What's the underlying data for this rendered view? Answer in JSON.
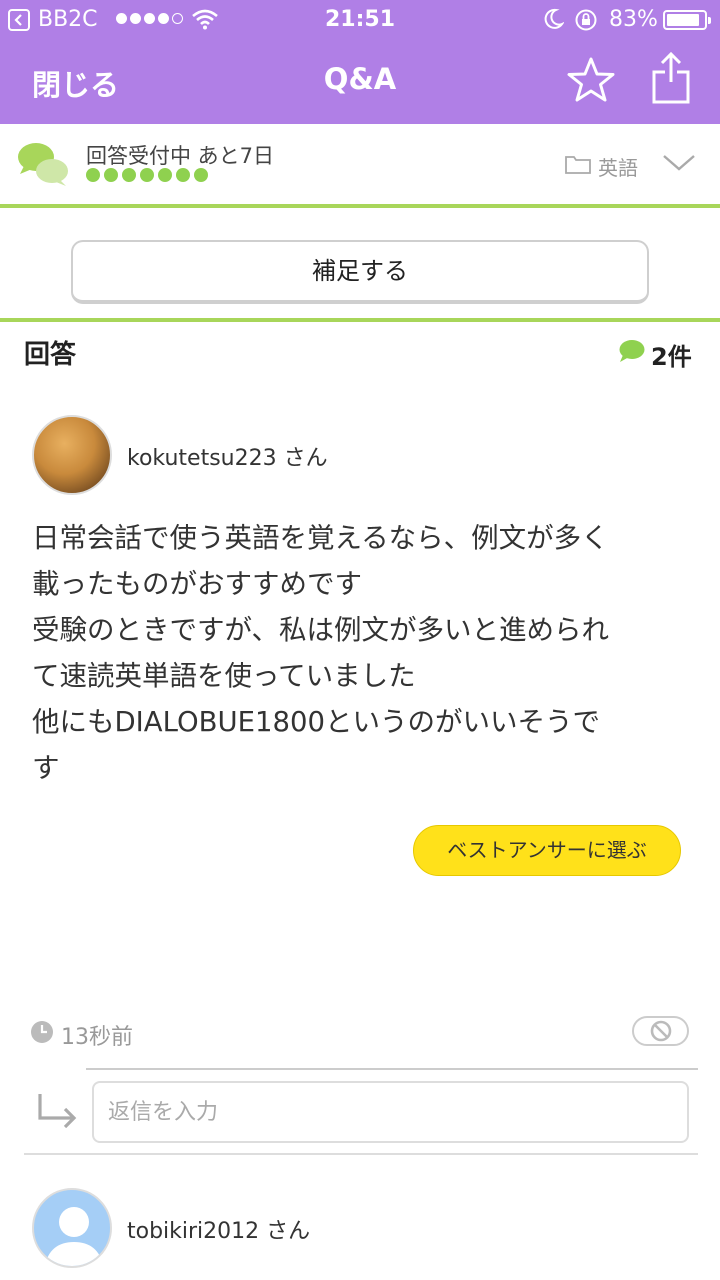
{
  "status_bar": {
    "carrier": "BB2C",
    "time": "21:51",
    "battery_percent": "83%"
  },
  "nav": {
    "close_label": "閉じる",
    "title": "Q&A",
    "icons": [
      "star-icon",
      "share-icon"
    ]
  },
  "question_status": {
    "status_text": "回答受付中 あと7日",
    "remaining_dots": 7,
    "category": "英語"
  },
  "supplement_button": "補足する",
  "answers_section": {
    "title": "回答",
    "count": "2件"
  },
  "answers": [
    {
      "user": "kokutetsu223 さん",
      "body": "日常会話で使う英語を覚えるなら、例文が多く\n載ったものがおすすめです\n受験のときですが、私は例文が多いと進められ\nて速読英単語を使っていました\n他にもDIALOBUE1800というのがいいそうで\nす",
      "best_answer_button": "ベストアンサーに選ぶ",
      "time_ago": "13秒前",
      "reply_placeholder": "返信を入力"
    },
    {
      "user": "tobikiri2012 さん"
    }
  ],
  "colors": {
    "header_bg": "#b07fe6",
    "accent_green": "#8fd14f",
    "best_button": "#ffe11a"
  }
}
